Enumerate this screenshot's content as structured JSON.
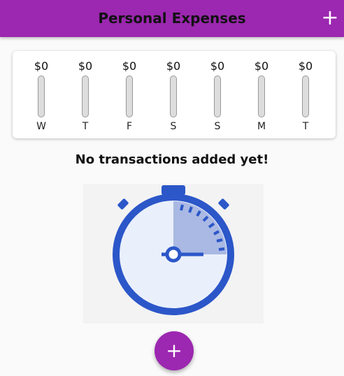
{
  "appbar": {
    "title": "Personal Expenses",
    "add_icon": "+"
  },
  "chart": {
    "days": [
      {
        "label": "W",
        "amount": "$0",
        "fraction": 0
      },
      {
        "label": "T",
        "amount": "$0",
        "fraction": 0
      },
      {
        "label": "F",
        "amount": "$0",
        "fraction": 0
      },
      {
        "label": "S",
        "amount": "$0",
        "fraction": 0
      },
      {
        "label": "S",
        "amount": "$0",
        "fraction": 0
      },
      {
        "label": "M",
        "amount": "$0",
        "fraction": 0
      },
      {
        "label": "T",
        "amount": "$0",
        "fraction": 0
      }
    ]
  },
  "empty_state": {
    "message": "No transactions added yet!",
    "image": "stopwatch-illustration"
  },
  "fab": {
    "icon": "+"
  },
  "colors": {
    "primary": "#9c27b0",
    "accent_blue": "#2c57c9"
  }
}
